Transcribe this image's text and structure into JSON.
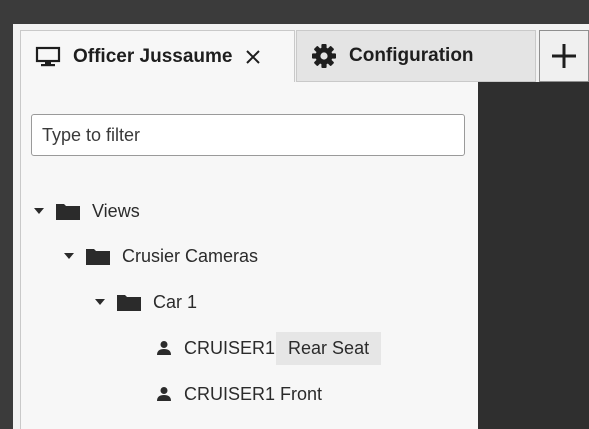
{
  "tabs": [
    {
      "label": "Officer Jussaume",
      "icon": "monitor-icon",
      "closable": true,
      "active": true
    },
    {
      "label": "Configuration",
      "icon": "gear-icon",
      "active": false
    }
  ],
  "add_tab": {
    "icon": "plus-icon"
  },
  "filter": {
    "placeholder": "Type to filter",
    "value": ""
  },
  "tree": {
    "views": {
      "label": "Views",
      "icon": "folder-icon",
      "expanded": true
    },
    "crusier_cameras": {
      "label": "Crusier Cameras",
      "icon": "folder-icon",
      "expanded": true
    },
    "car1": {
      "label": "Car 1",
      "icon": "folder-icon",
      "expanded": true
    },
    "cameras": [
      {
        "label": "CRUISER1",
        "suffix": "Rear Seat",
        "icon": "person-icon",
        "hover": true
      },
      {
        "label": "CRUISER1 Front",
        "icon": "person-icon"
      }
    ]
  },
  "colors": {
    "chrome": "#3b3b3b",
    "pane": "#2f2f2f",
    "panel": "#f7f7f7",
    "hover": "#e6e6e6"
  }
}
